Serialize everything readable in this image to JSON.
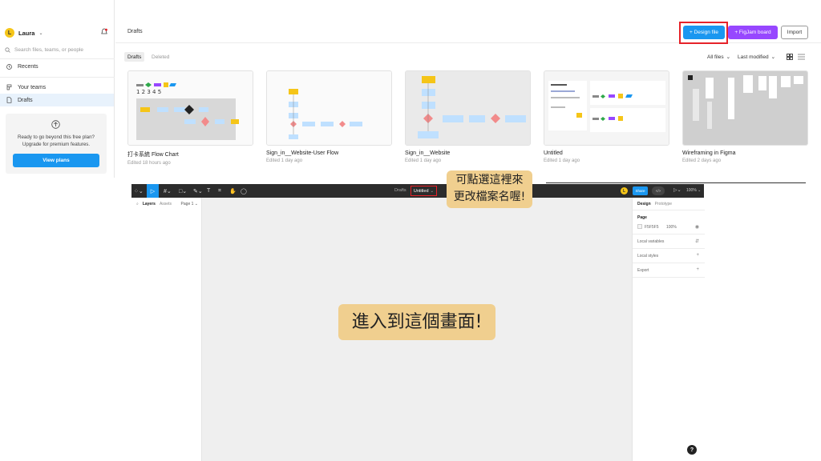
{
  "sidebar": {
    "user": {
      "initial": "L",
      "name": "Laura"
    },
    "search_placeholder": "Search files, teams, or people",
    "nav": {
      "recents": "Recents",
      "your_teams": "Your teams",
      "drafts": "Drafts"
    },
    "upgrade": {
      "text": "Ready to go beyond this free plan? Upgrade for premium features.",
      "button": "View plans"
    }
  },
  "header": {
    "title": "Drafts",
    "design_file_button": "+ Design file",
    "figjam_button": "+ FigJam board",
    "import_button": "Import"
  },
  "tabs": {
    "drafts": "Drafts",
    "deleted": "Deleted"
  },
  "filters": {
    "all_files": "All files",
    "last_modified": "Last modified"
  },
  "files": [
    {
      "name": "打卡系統 Flow Chart",
      "edited": "Edited 18 hours ago"
    },
    {
      "name": "Sign_in__Website-User Flow",
      "edited": "Edited 1 day ago"
    },
    {
      "name": "Sign_in__Website",
      "edited": "Edited 1 day ago"
    },
    {
      "name": "Untitled",
      "edited": "Edited 1 day ago"
    },
    {
      "name": "Wireframing in Figma",
      "edited": "Edited 2 days ago"
    }
  ],
  "editor": {
    "breadcrumb": "Drafts",
    "filename": "Untitled",
    "avatar_initial": "L",
    "share": "Share",
    "code": "</>",
    "zoom": "100%",
    "left_tabs": {
      "layers": "Layers",
      "assets": "Assets",
      "page_select": "Page 1"
    },
    "right_tabs": {
      "design": "Design",
      "prototype": "Prototype"
    },
    "right_panel": {
      "page_label": "Page",
      "page_color": "F5F5F5",
      "page_opacity": "100%",
      "local_variables": "Local variables",
      "local_styles": "Local styles",
      "export": "Export"
    }
  },
  "annotations": {
    "rename_hint_line1": "可點選這裡來",
    "rename_hint_line2": "更改檔案名喔!",
    "enter_screen": "進入到這個畫面!"
  },
  "help": "?",
  "colors": {
    "accent_blue": "#1a97f0",
    "figjam_purple": "#9747ff",
    "highlight_red": "#e62229",
    "callout_bg": "#f0cf8f",
    "avatar_yellow": "#f5c518"
  }
}
